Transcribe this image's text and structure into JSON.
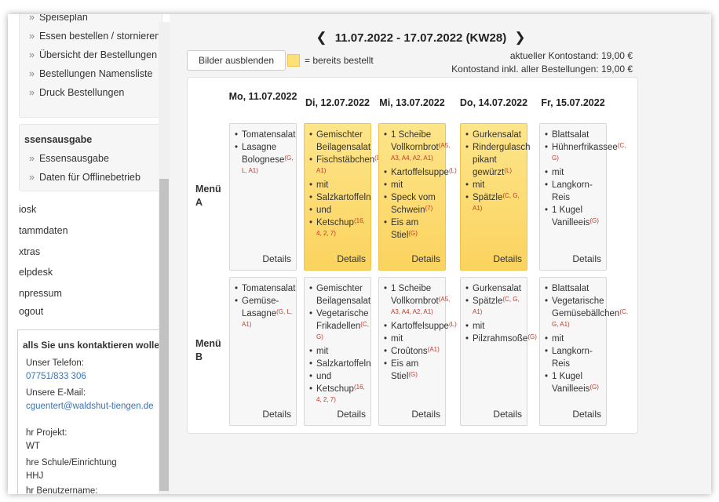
{
  "sidebar": {
    "group1": [
      "Speiseplan",
      "Essen bestellen / stornieren",
      "Übersicht der Bestellungen",
      "Bestellungen Namensliste",
      "Druck Bestellungen"
    ],
    "group2_heading": "ssensausgabe",
    "group2": [
      "Essensausgabe",
      "Daten für Offlinebetrieb"
    ],
    "links": [
      "iosk",
      "tammdaten",
      "xtras",
      "elpdesk",
      "npressum",
      "ogout"
    ],
    "bullet": "»"
  },
  "contact": {
    "heading": "alls Sie uns kontaktieren wollen:",
    "phone_label": "Unser Telefon:",
    "phone": "07751/833 306",
    "email_label": "Unsere E-Mail:",
    "email": "cguentert@waldshut-tiengen.de",
    "project_label": "hr Projekt:",
    "project": "WT",
    "school_label": "hre Schule/Einrichtung",
    "school": "HHJ",
    "username_label": "hr Benutzername:"
  },
  "header": {
    "prev_arrow": "❮",
    "next_arrow": "❯",
    "week_range": "11.07.2022 - 17.07.2022 (KW28)",
    "hide_images_button": "Bilder ausblenden",
    "legend_text": "= bereits bestellt",
    "balance_current": "aktueller Kontostand: 19,00 €",
    "balance_incl": "Kontostand inkl. aller Bestellungen: 19,00 €"
  },
  "colors": {
    "ordered": "#fde07a",
    "allergen": "#c0392b"
  },
  "days": [
    "Mo, 11.07.2022",
    "Di, 12.07.2022",
    "Mi, 13.07.2022",
    "Do, 14.07.2022",
    "Fr, 15.07.2022"
  ],
  "menus": [
    {
      "label": "Menü A",
      "cells": [
        {
          "ordered": false,
          "details": "Details",
          "items": [
            {
              "text": "Tomatensalat",
              "sup": ""
            },
            {
              "text": "Lasagne Bolognese",
              "sup": "(G, L, A1)"
            }
          ]
        },
        {
          "ordered": true,
          "details": "Details",
          "items": [
            {
              "text": "Gemischter Beilagensalat",
              "sup": ""
            },
            {
              "text": "Fischstäbchen",
              "sup": "(D, A1)"
            },
            {
              "text": "mit",
              "sup": ""
            },
            {
              "text": "Salzkartoffeln",
              "sup": ""
            },
            {
              "text": "und",
              "sup": ""
            },
            {
              "text": "Ketschup",
              "sup": "(16, 4, 2, 7)"
            }
          ]
        },
        {
          "ordered": true,
          "details": "Details",
          "items": [
            {
              "text": "1 Scheibe Vollkornbrot",
              "sup": "(A5, A3, A4, A2, A1)"
            },
            {
              "text": "Kartoffelsuppe",
              "sup": "(L)"
            },
            {
              "text": "mit",
              "sup": ""
            },
            {
              "text": "Speck vom Schwein",
              "sup": "(7)"
            },
            {
              "text": "Eis am Stiel",
              "sup": "(G)"
            }
          ]
        },
        {
          "ordered": true,
          "details": "Details",
          "items": [
            {
              "text": "Gurkensalat",
              "sup": ""
            },
            {
              "text": "Rindergulasch pikant gewürzt",
              "sup": "(L)"
            },
            {
              "text": "mit",
              "sup": ""
            },
            {
              "text": "Spätzle",
              "sup": "(C, G, A1)"
            }
          ]
        },
        {
          "ordered": false,
          "details": "Details",
          "items": [
            {
              "text": "Blattsalat",
              "sup": ""
            },
            {
              "text": "Hühnerfrikassee",
              "sup": "(C, G)"
            },
            {
              "text": "mit",
              "sup": ""
            },
            {
              "text": "Langkorn-Reis",
              "sup": ""
            },
            {
              "text": "1 Kugel Vanilleeis",
              "sup": "(G)"
            }
          ]
        }
      ]
    },
    {
      "label": "Menü B",
      "cells": [
        {
          "ordered": false,
          "details": "Details",
          "items": [
            {
              "text": "Tomatensalat",
              "sup": ""
            },
            {
              "text": "Gemüse-Lasagne",
              "sup": "(G, L, A1)"
            }
          ]
        },
        {
          "ordered": false,
          "details": "Details",
          "items": [
            {
              "text": "Gemischter Beilagensalat",
              "sup": ""
            },
            {
              "text": "Vegetarische Frikadellen",
              "sup": "(C, G)"
            },
            {
              "text": "mit",
              "sup": ""
            },
            {
              "text": "Salzkartoffeln",
              "sup": ""
            },
            {
              "text": "und",
              "sup": ""
            },
            {
              "text": "Ketschup",
              "sup": "(16, 4, 2, 7)"
            }
          ]
        },
        {
          "ordered": false,
          "details": "Details",
          "items": [
            {
              "text": "1 Scheibe Vollkornbrot",
              "sup": "(A5, A3, A4, A2, A1)"
            },
            {
              "text": "Kartoffelsuppe",
              "sup": "(L)"
            },
            {
              "text": "mit",
              "sup": ""
            },
            {
              "text": "Croûtons",
              "sup": "(A1)"
            },
            {
              "text": "Eis am Stiel",
              "sup": "(G)"
            }
          ]
        },
        {
          "ordered": false,
          "details": "Details",
          "items": [
            {
              "text": "Gurkensalat",
              "sup": ""
            },
            {
              "text": "Spätzle",
              "sup": "(C, G, A1)"
            },
            {
              "text": "mit",
              "sup": ""
            },
            {
              "text": "Pilzrahmsoße",
              "sup": "(G)"
            }
          ]
        },
        {
          "ordered": false,
          "details": "Details",
          "items": [
            {
              "text": "Blattsalat",
              "sup": ""
            },
            {
              "text": "Vegetarische Gemüsebällchen",
              "sup": "(C, G, A1)"
            },
            {
              "text": "mit",
              "sup": ""
            },
            {
              "text": "Langkorn-Reis",
              "sup": ""
            },
            {
              "text": "1 Kugel Vanilleeis",
              "sup": "(G)"
            }
          ]
        }
      ]
    }
  ]
}
